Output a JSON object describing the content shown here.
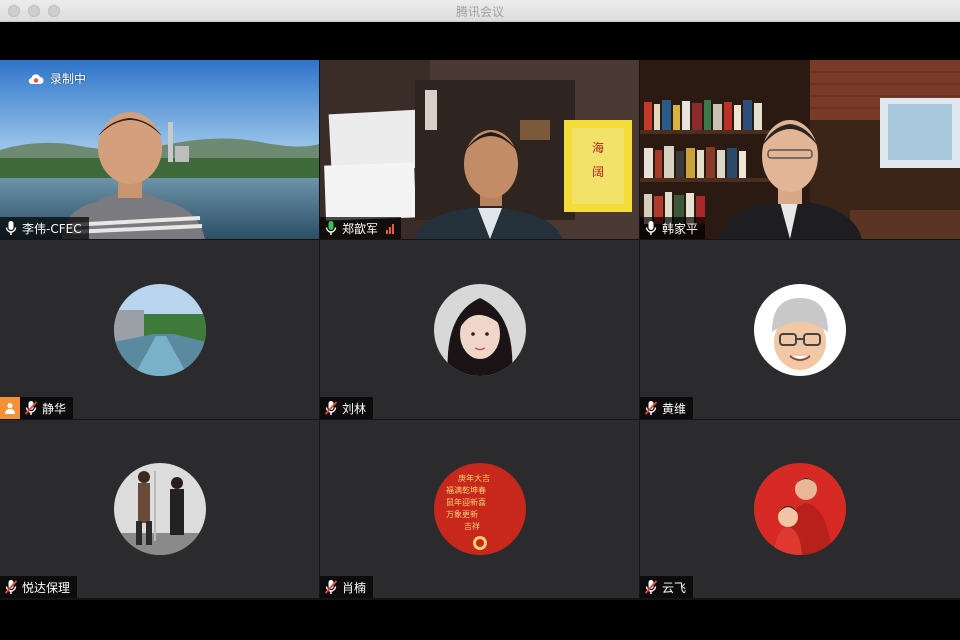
{
  "window": {
    "title": "腾讯会议"
  },
  "recording": {
    "label": "录制中",
    "icon": "cloud-record-icon",
    "color": "#f04a3a"
  },
  "colors": {
    "active_speaker": "#3fbf5a",
    "tile_bg": "#2b2b2e",
    "nameplate_bg": "#000000b3",
    "muted": "#e5453a"
  },
  "participants": [
    {
      "name": "李伟-CFEC",
      "video": true,
      "mic": "on",
      "scene": "lake-power-plant"
    },
    {
      "name": "郑歆军",
      "video": true,
      "mic": "on",
      "speaking": true,
      "signal_bars": 3,
      "scene": "office-calligraphy"
    },
    {
      "name": "韩家平",
      "video": true,
      "mic": "on",
      "scene": "bookshelf-study"
    },
    {
      "name": "静华",
      "video": false,
      "mic": "muted",
      "host_badge": "person-icon",
      "avatar": "river-photo"
    },
    {
      "name": "刘林",
      "video": false,
      "mic": "muted",
      "avatar": "woman-portrait"
    },
    {
      "name": "黄维",
      "video": false,
      "mic": "muted",
      "avatar": "memoji-glasses-hat"
    },
    {
      "name": "悦达保理",
      "video": false,
      "mic": "muted",
      "avatar": "gym-photo"
    },
    {
      "name": "肖楠",
      "video": false,
      "mic": "muted",
      "avatar": "red-calligraphy"
    },
    {
      "name": "云飞",
      "video": false,
      "mic": "muted",
      "avatar": "family-red-background"
    }
  ]
}
